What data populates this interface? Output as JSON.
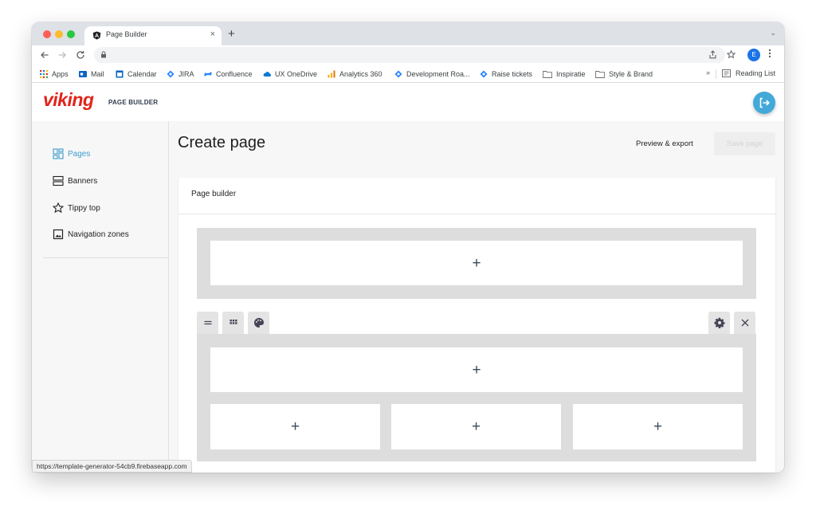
{
  "browser": {
    "tab_title": "Page Builder",
    "tab_close": "×",
    "new_tab": "+",
    "tab_menu": "⌄",
    "profile_initial": "E",
    "status_url": "https://template-generator-54cb9.firebaseapp.com"
  },
  "bookmarks": {
    "items": [
      "Apps",
      "Mail",
      "Calendar",
      "JIRA",
      "Confluence",
      "UX OneDrive",
      "Analytics 360",
      "Development Roa...",
      "Raise tickets",
      "Inspiratie",
      "Style & Brand"
    ],
    "more": "»",
    "reading_list": "Reading List"
  },
  "app": {
    "logo": "viking",
    "logo_sub": "PAGE BUILDER",
    "sidebar": {
      "items": [
        {
          "label": "Pages",
          "icon": "grid-icon",
          "active": true
        },
        {
          "label": "Banners",
          "icon": "rows-icon",
          "active": false
        },
        {
          "label": "Tippy top",
          "icon": "star-icon",
          "active": false
        },
        {
          "label": "Navigation zones",
          "icon": "image-icon",
          "active": false
        }
      ]
    },
    "header": {
      "title": "Create page",
      "preview_label": "Preview & export",
      "save_label": "Save page"
    },
    "builder": {
      "card_title": "Page builder",
      "add_symbol": "+"
    }
  },
  "colors": {
    "accent": "#42a9d8",
    "brand_red": "#e2231a",
    "active_link": "#3d9ccc"
  }
}
